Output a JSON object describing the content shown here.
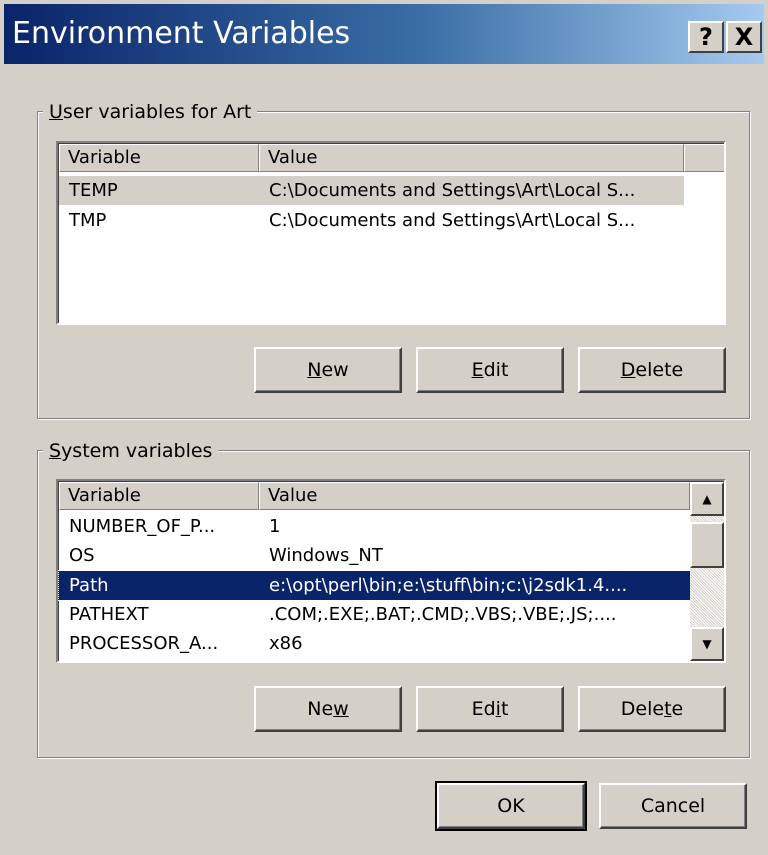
{
  "window": {
    "title": "Environment Variables",
    "help_glyph": "?",
    "close_glyph": "X"
  },
  "user_group": {
    "label_pre": "",
    "label_accel": "U",
    "label_post": "ser variables for Art",
    "columns": [
      "Variable",
      "Value"
    ],
    "rows": [
      {
        "variable": "TEMP",
        "value": "C:\\Documents and Settings\\Art\\Local S..."
      },
      {
        "variable": "TMP",
        "value": "C:\\Documents and Settings\\Art\\Local S..."
      }
    ],
    "buttons": {
      "new": {
        "pre": "",
        "accel": "N",
        "post": "ew"
      },
      "edit": {
        "pre": "",
        "accel": "E",
        "post": "dit"
      },
      "delete": {
        "pre": "",
        "accel": "D",
        "post": "elete"
      }
    }
  },
  "system_group": {
    "label_pre": "",
    "label_accel": "S",
    "label_post": "ystem variables",
    "columns": [
      "Variable",
      "Value"
    ],
    "rows": [
      {
        "variable": "NUMBER_OF_P...",
        "value": "1"
      },
      {
        "variable": "OS",
        "value": "Windows_NT"
      },
      {
        "variable": "Path",
        "value": "e:\\opt\\perl\\bin;e:\\stuff\\bin;c:\\j2sdk1.4...."
      },
      {
        "variable": "PATHEXT",
        "value": ".COM;.EXE;.BAT;.CMD;.VBS;.VBE;.JS;...."
      },
      {
        "variable": "PROCESSOR_A...",
        "value": "x86"
      }
    ],
    "buttons": {
      "new": {
        "pre": "Ne",
        "accel": "w",
        "post": ""
      },
      "edit": {
        "pre": "Ed",
        "accel": "i",
        "post": "t"
      },
      "delete": {
        "pre": "Dele",
        "accel": "t",
        "post": "e"
      }
    }
  },
  "footer": {
    "ok": "OK",
    "cancel": "Cancel"
  },
  "icons": {
    "scroll_up": "▲",
    "scroll_down": "▼"
  },
  "colors": {
    "titlebar_start": "#0a246a",
    "titlebar_end": "#a6caf0",
    "face": "#d4d0c8",
    "selection": "#0a246a"
  }
}
